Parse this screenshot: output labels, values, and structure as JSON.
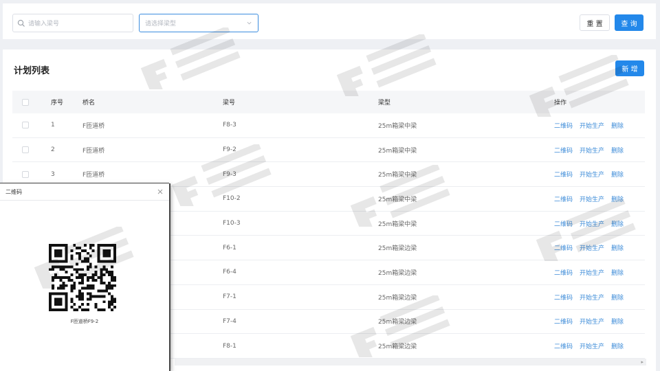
{
  "search": {
    "placeholder": "请输入梁号",
    "select_placeholder": "请选择梁型",
    "reset_label": "重 置",
    "query_label": "查 询"
  },
  "list": {
    "title": "计划列表",
    "add_label": "新 增",
    "columns": [
      "序号",
      "桥名",
      "梁号",
      "梁型",
      "操作"
    ],
    "ops": [
      "二维码",
      "开始生产",
      "删除"
    ],
    "rows": [
      {
        "idx": "1",
        "name": "F匝道桥",
        "code": "F8-3",
        "type": "25m箱梁中梁"
      },
      {
        "idx": "2",
        "name": "F匝道桥",
        "code": "F9-2",
        "type": "25m箱梁中梁"
      },
      {
        "idx": "3",
        "name": "F匝道桥",
        "code": "F9-3",
        "type": "25m箱梁中梁"
      },
      {
        "idx": "",
        "name": "",
        "code": "F10-2",
        "type": "25m箱梁中梁"
      },
      {
        "idx": "",
        "name": "",
        "code": "F10-3",
        "type": "25m箱梁中梁"
      },
      {
        "idx": "",
        "name": "",
        "code": "F6-1",
        "type": "25m箱梁边梁"
      },
      {
        "idx": "",
        "name": "",
        "code": "F6-4",
        "type": "25m箱梁边梁"
      },
      {
        "idx": "",
        "name": "",
        "code": "F7-1",
        "type": "25m箱梁边梁"
      },
      {
        "idx": "",
        "name": "",
        "code": "F7-4",
        "type": "25m箱梁边梁"
      },
      {
        "idx": "",
        "name": "",
        "code": "F8-1",
        "type": "25m箱梁边梁"
      }
    ]
  },
  "dialog": {
    "title": "二维码",
    "caption": "F匝道桥F9-2"
  },
  "colors": {
    "primary": "#2388ea",
    "link": "#3c8bd8"
  },
  "icons": {
    "search": "search-icon",
    "select": "chevron-down-icon",
    "close": "close-icon",
    "qr": "qr-code-icon"
  }
}
